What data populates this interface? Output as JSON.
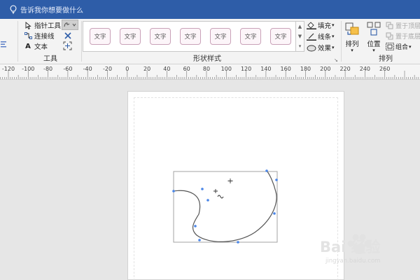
{
  "titlebar": {
    "tell_me": "告诉我你想要做什么"
  },
  "tools": {
    "pointer": "指针工具",
    "connector": "连接线",
    "text": "文本",
    "group_label": "工具"
  },
  "shape_styles": {
    "items": [
      "文字",
      "文字",
      "文字",
      "文字",
      "文字",
      "文字",
      "文字"
    ],
    "fill": "填充",
    "line": "线条",
    "effects": "效果",
    "group_label": "形状样式"
  },
  "arrange": {
    "arrange": "排列",
    "position": "位置",
    "bring_front": "置于顶层",
    "send_back": "置于底层",
    "group": "组合",
    "group_label": "排列"
  },
  "ruler": {
    "ticks": [
      "-120",
      "-100",
      "-80",
      "-60",
      "-40",
      "-20",
      "0",
      "20",
      "40",
      "60",
      "80",
      "100",
      "120",
      "140",
      "160",
      "180",
      "200",
      "220",
      "240",
      "260"
    ]
  },
  "watermark": {
    "brand": "Bai 经验",
    "sub": "jingyan.baidu.com"
  },
  "colors": {
    "titlebar": "#2e5da8",
    "handle": "#4a86e8",
    "style_border": "#c9a1b8"
  }
}
